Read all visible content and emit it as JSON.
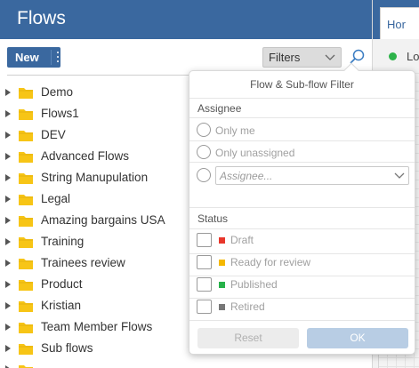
{
  "header": {
    "title": "Flows"
  },
  "toolbar": {
    "new_label": "New",
    "filters_label": "Filters"
  },
  "tree": {
    "items": [
      {
        "label": "Demo"
      },
      {
        "label": "Flows1"
      },
      {
        "label": "DEV"
      },
      {
        "label": "Advanced Flows"
      },
      {
        "label": "String Manupulation"
      },
      {
        "label": "Legal"
      },
      {
        "label": "Amazing bargains USA"
      },
      {
        "label": "Training"
      },
      {
        "label": "Trainees review"
      },
      {
        "label": "Product"
      },
      {
        "label": "Kristian"
      },
      {
        "label": "Team Member Flows"
      },
      {
        "label": "Sub flows"
      }
    ]
  },
  "right_panel": {
    "tab_label": "Hor",
    "status_text": "Lo",
    "status_color": "#2db34a"
  },
  "filter": {
    "title": "Flow & Sub-flow Filter",
    "assignee_heading": "Assignee",
    "assignee_options": [
      {
        "label": "Only me"
      },
      {
        "label": "Only unassigned"
      }
    ],
    "assignee_placeholder": "Assignee...",
    "status_heading": "Status",
    "statuses": [
      {
        "label": "Draft",
        "color": "#e8362b"
      },
      {
        "label": "Ready for review",
        "color": "#f5b800"
      },
      {
        "label": "Published",
        "color": "#27b24a"
      },
      {
        "label": "Retired",
        "color": "#777777"
      }
    ],
    "reset_label": "Reset",
    "ok_label": "OK"
  },
  "colors": {
    "brand": "#3a689f",
    "folder": "#f7c516"
  }
}
